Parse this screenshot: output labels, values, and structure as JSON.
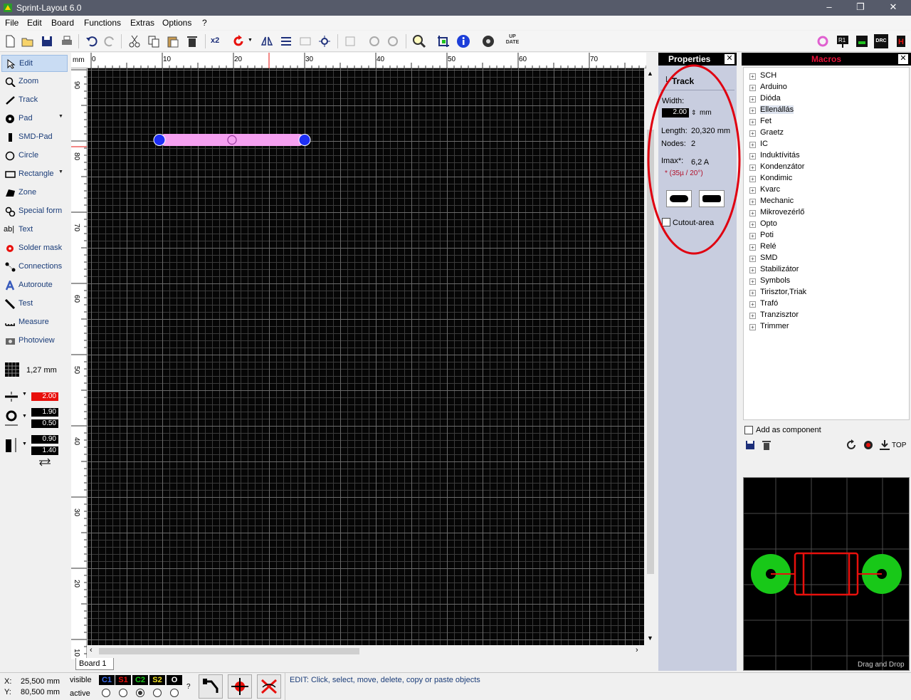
{
  "app": {
    "title": "Sprint-Layout 6.0"
  },
  "menu": [
    "File",
    "Edit",
    "Board",
    "Functions",
    "Extras",
    "Options",
    "?"
  ],
  "toolbar": {
    "icons": [
      "new-file-icon",
      "open-folder-icon",
      "save-icon",
      "print-icon",
      "undo-icon",
      "redo-icon",
      "cut-icon",
      "copy-icon",
      "paste-icon",
      "delete-icon",
      "x2-icon",
      "rotate-icon",
      "mirror-icon",
      "align-icon",
      "group-icon",
      "ungroup-icon",
      "layer-icon",
      "lock-icon",
      "unlock-icon",
      "zoom-icon",
      "crop-icon",
      "info-icon",
      "settings-icon",
      "update-icon",
      "macro-icon",
      "r1-icon",
      "drc-icon",
      "h-icon"
    ],
    "x2_label": "x2",
    "update_label": "UP DATE",
    "drc_label": "DRC"
  },
  "left_tools": [
    {
      "label": "Edit",
      "icon": "cursor-icon"
    },
    {
      "label": "Zoom",
      "icon": "zoom-icon"
    },
    {
      "label": "Track",
      "icon": "track-icon"
    },
    {
      "label": "Pad",
      "icon": "pad-icon"
    },
    {
      "label": "SMD-Pad",
      "icon": "smd-pad-icon"
    },
    {
      "label": "Circle",
      "icon": "circle-icon"
    },
    {
      "label": "Rectangle",
      "icon": "rectangle-icon"
    },
    {
      "label": "Zone",
      "icon": "zone-icon"
    },
    {
      "label": "Special form",
      "icon": "special-form-icon"
    },
    {
      "label": "Text",
      "icon": "text-icon"
    },
    {
      "label": "Solder mask",
      "icon": "solder-mask-icon"
    },
    {
      "label": "Connections",
      "icon": "connections-icon"
    },
    {
      "label": "Autoroute",
      "icon": "autoroute-icon"
    },
    {
      "label": "Test",
      "icon": "test-icon"
    },
    {
      "label": "Measure",
      "icon": "measure-icon"
    },
    {
      "label": "Photoview",
      "icon": "photoview-icon"
    }
  ],
  "text_tool_prefix": "ab|",
  "grid": {
    "label": "1,27 mm"
  },
  "track_width": "2.00",
  "pad_outer": "1.90",
  "pad_inner": "0.50",
  "smd_w": "0.90",
  "smd_h": "1.40",
  "ruler": {
    "unit": "mm",
    "top": [
      "0",
      "10",
      "20",
      "30",
      "40",
      "50",
      "60",
      "70"
    ],
    "left": [
      "90",
      "80",
      "70",
      "60",
      "50",
      "40",
      "30",
      "20",
      "10"
    ]
  },
  "board_tab": "Board 1",
  "properties": {
    "title": "Properties",
    "type": "Track",
    "width_label": "Width:",
    "width_value": "2.00",
    "width_unit": "mm",
    "length_label": "Length:",
    "length_value": "20,320 mm",
    "nodes_label": "Nodes:",
    "nodes_value": "2",
    "imax_label": "Imax*:",
    "imax_value": "6,2 A",
    "imax_note": "* (35µ / 20°)",
    "cutout_label": "Cutout-area"
  },
  "macros": {
    "title": "Macros",
    "items": [
      "SCH",
      "Arduino",
      "Dióda",
      "Ellenállás",
      "Fet",
      "Graetz",
      "IC",
      "Induktívitás",
      "Kondenzátor",
      "Kondimic",
      "Kvarc",
      "Mechanic",
      "Mikrovezérlő",
      "Opto",
      "Poti",
      "Relé",
      "SMD",
      "Stabilizátor",
      "Symbols",
      "Tirisztor,Triak",
      "Trafó",
      "Tranzisztor",
      "Trimmer"
    ],
    "add_component": "Add as component",
    "top_label": "TOP",
    "drag_drop": "Drag and Drop"
  },
  "status": {
    "x_label": "X:",
    "x_value": "25,500 mm",
    "y_label": "Y:",
    "y_value": "80,500 mm",
    "visible": "visible",
    "active": "active",
    "layers": [
      {
        "name": "C1",
        "color": "#3a6cf0"
      },
      {
        "name": "S1",
        "color": "#e8100c"
      },
      {
        "name": "C2",
        "color": "#19c819"
      },
      {
        "name": "S2",
        "color": "#f0e020"
      },
      {
        "name": "O",
        "color": "#ffffff"
      }
    ],
    "question": "?",
    "message": "EDIT:  Click, select, move, delete, copy or paste objects"
  },
  "colors": {
    "track_fill": "#f5a0f0",
    "node": "#1e2ff5",
    "annotation": "#e00010",
    "pad_green": "#18c818"
  }
}
